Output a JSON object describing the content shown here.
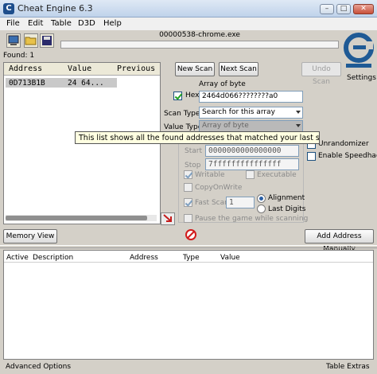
{
  "window": {
    "title": "Cheat Engine 6.3"
  },
  "menu": [
    "File",
    "Edit",
    "Table",
    "D3D",
    "Help"
  ],
  "process": {
    "name": "00000538-chrome.exe"
  },
  "found_label": "Found: 1",
  "results": {
    "columns": [
      "Address",
      "Value",
      "Previous"
    ],
    "rows": [
      {
        "address": "0D713B1B",
        "value": "24 64...",
        "previous": ""
      }
    ]
  },
  "buttons": {
    "new_scan": "New Scan",
    "next_scan": "Next Scan",
    "undo_scan": "Undo Scan",
    "memory_view": "Memory View",
    "add_address": "Add Address Manually"
  },
  "settings_label": "Settings",
  "scan": {
    "value_heading": "Array of byte",
    "hex_label": "Hex",
    "hex_checked": true,
    "value": "2464d066????????a0",
    "scan_type_label": "Scan Type",
    "scan_type": "Search for this array",
    "value_type_label": "Value Type",
    "value_type": "Array of byte"
  },
  "tooltip": "This list shows all the found addresses that matched your last scan",
  "options": {
    "start_label": "Start",
    "start_value": "0000000000000000",
    "stop_label": "Stop",
    "stop_value": "7fffffffffffffff",
    "writable": "Writable",
    "executable": "Executable",
    "copy_on_write": "CopyOnWrite",
    "fast_scan": "Fast Scan",
    "fast_scan_value": "1",
    "alignment": "Alignment",
    "last_digits": "Last Digits",
    "pause_game": "Pause the game while scanning",
    "unrandomizer": "Unrandomizer",
    "enable_speedhack": "Enable Speedhack"
  },
  "address_list": {
    "columns": [
      "Active",
      "Description",
      "Address",
      "Type",
      "Value"
    ]
  },
  "footer": {
    "advanced": "Advanced Options",
    "table_extras": "Table Extras"
  }
}
